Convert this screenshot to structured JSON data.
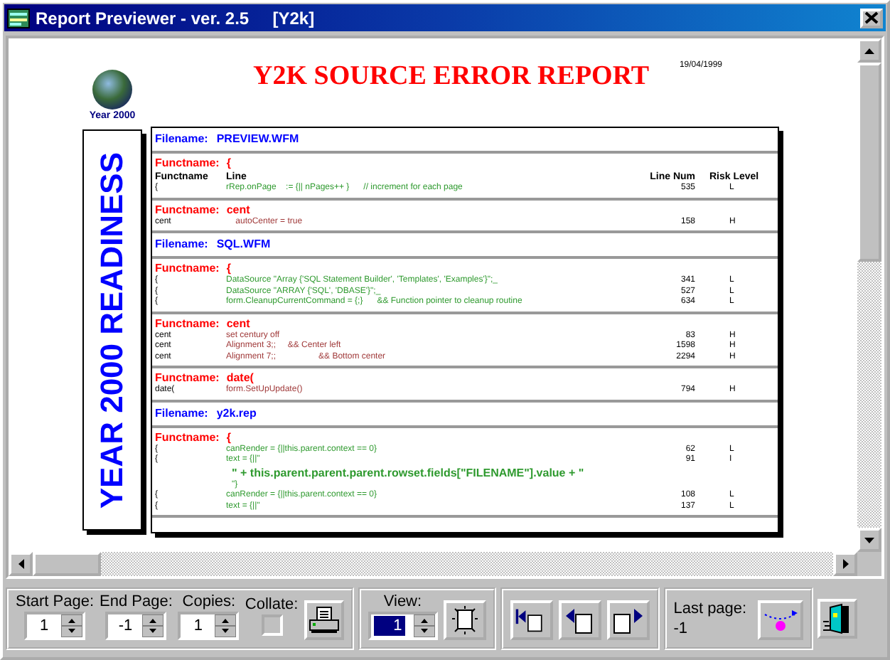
{
  "window": {
    "title": "Report Previewer - ver. 2.5     [Y2k]"
  },
  "report": {
    "logo_caption": "Year 2000",
    "banner": "YEAR 2000 READINESS",
    "title": "Y2K SOURCE ERROR REPORT",
    "date": "19/04/1999",
    "sections": [
      {
        "kind": "file",
        "label": "Filename:",
        "name": "PREVIEW.WFM"
      },
      {
        "kind": "func",
        "label": "Functname:",
        "name": "{",
        "color": "#2f9a2f",
        "columns": [
          "Functname",
          "Line",
          "Line Num",
          "Risk Level"
        ],
        "rows": [
          {
            "kind": "line",
            "funct": "{",
            "code": "rRep.onPage    := {|| nPages++ }      // increment for each page",
            "line": "535",
            "risk": "L"
          }
        ]
      },
      {
        "kind": "func",
        "label": "Functname:",
        "name": "cent",
        "color": "#a03a3a",
        "rows": [
          {
            "kind": "line",
            "funct": "cent",
            "code": "    autoCenter = true",
            "line": "158",
            "risk": "H"
          }
        ]
      },
      {
        "kind": "file",
        "label": "Filename:",
        "name": "SQL.WFM"
      },
      {
        "kind": "func",
        "label": "Functname:",
        "name": "{",
        "color": "#2f9a2f",
        "rows": [
          {
            "kind": "line",
            "funct": "{",
            "code": "DataSource \"Array {'SQL Statement Builder', 'Templates', 'Examples'}\";_",
            "line": "341",
            "risk": "L"
          },
          {
            "kind": "line",
            "funct": "{",
            "code": "DataSource \"ARRAY {'SQL', 'DBASE'}\";_",
            "line": "527",
            "risk": "L"
          },
          {
            "kind": "line",
            "funct": "{",
            "code": "form.CleanupCurrentCommand = {;}      && Function pointer to cleanup routine",
            "line": "634",
            "risk": "L"
          }
        ]
      },
      {
        "kind": "func",
        "label": "Functname:",
        "name": "cent",
        "color": "#a03a3a",
        "rows": [
          {
            "kind": "line",
            "funct": "cent",
            "code": "set century off",
            "line": "83",
            "risk": "H"
          },
          {
            "kind": "line",
            "funct": "cent",
            "code": "Alignment 3;;     && Center left",
            "line": "1598",
            "risk": "H"
          },
          {
            "kind": "line",
            "funct": "cent",
            "code": "Alignment 7;;                  && Bottom center",
            "line": "2294",
            "risk": "H"
          }
        ]
      },
      {
        "kind": "func",
        "label": "Functname:",
        "name": "date(",
        "color": "#a03a3a",
        "rows": [
          {
            "kind": "line",
            "funct": "date(",
            "code": "form.SetUpUpdate()",
            "line": "794",
            "risk": "H"
          }
        ]
      },
      {
        "kind": "file",
        "label": "Filename:",
        "name": "y2k.rep"
      },
      {
        "kind": "func",
        "label": "Functname:",
        "name": "{",
        "color": "#2f9a2f",
        "rows": [
          {
            "kind": "line",
            "funct": "{",
            "code": "canRender = {||this.parent.context == 0}",
            "line": "62",
            "risk": "L"
          },
          {
            "kind": "line",
            "funct": "{",
            "code": "text = {||\"",
            "line": "91",
            "risk": "I"
          },
          {
            "kind": "continuation",
            "emphasis": true,
            "code": "\" + this.parent.parent.parent.rowset.fields[\"FILENAME\"].value + \""
          },
          {
            "kind": "continuation",
            "emphasis": false,
            "code": "\"}"
          },
          {
            "kind": "line",
            "funct": "{",
            "code": "canRender = {||this.parent.context == 0}",
            "line": "108",
            "risk": "L"
          },
          {
            "kind": "line",
            "funct": "{",
            "code": "text = {||\"",
            "line": "137",
            "risk": "L"
          }
        ]
      }
    ]
  },
  "toolbar": {
    "start_page": {
      "label": "Start Page:",
      "value": "1"
    },
    "end_page": {
      "label": "End Page:",
      "value": "-1"
    },
    "copies": {
      "label": "Copies:",
      "value": "1"
    },
    "collate": {
      "label": "Collate:",
      "checked": false
    },
    "view": {
      "label": "View:",
      "value": "1",
      "highlighted": true
    },
    "last_page": {
      "label": "Last page:",
      "value": "-1"
    }
  }
}
